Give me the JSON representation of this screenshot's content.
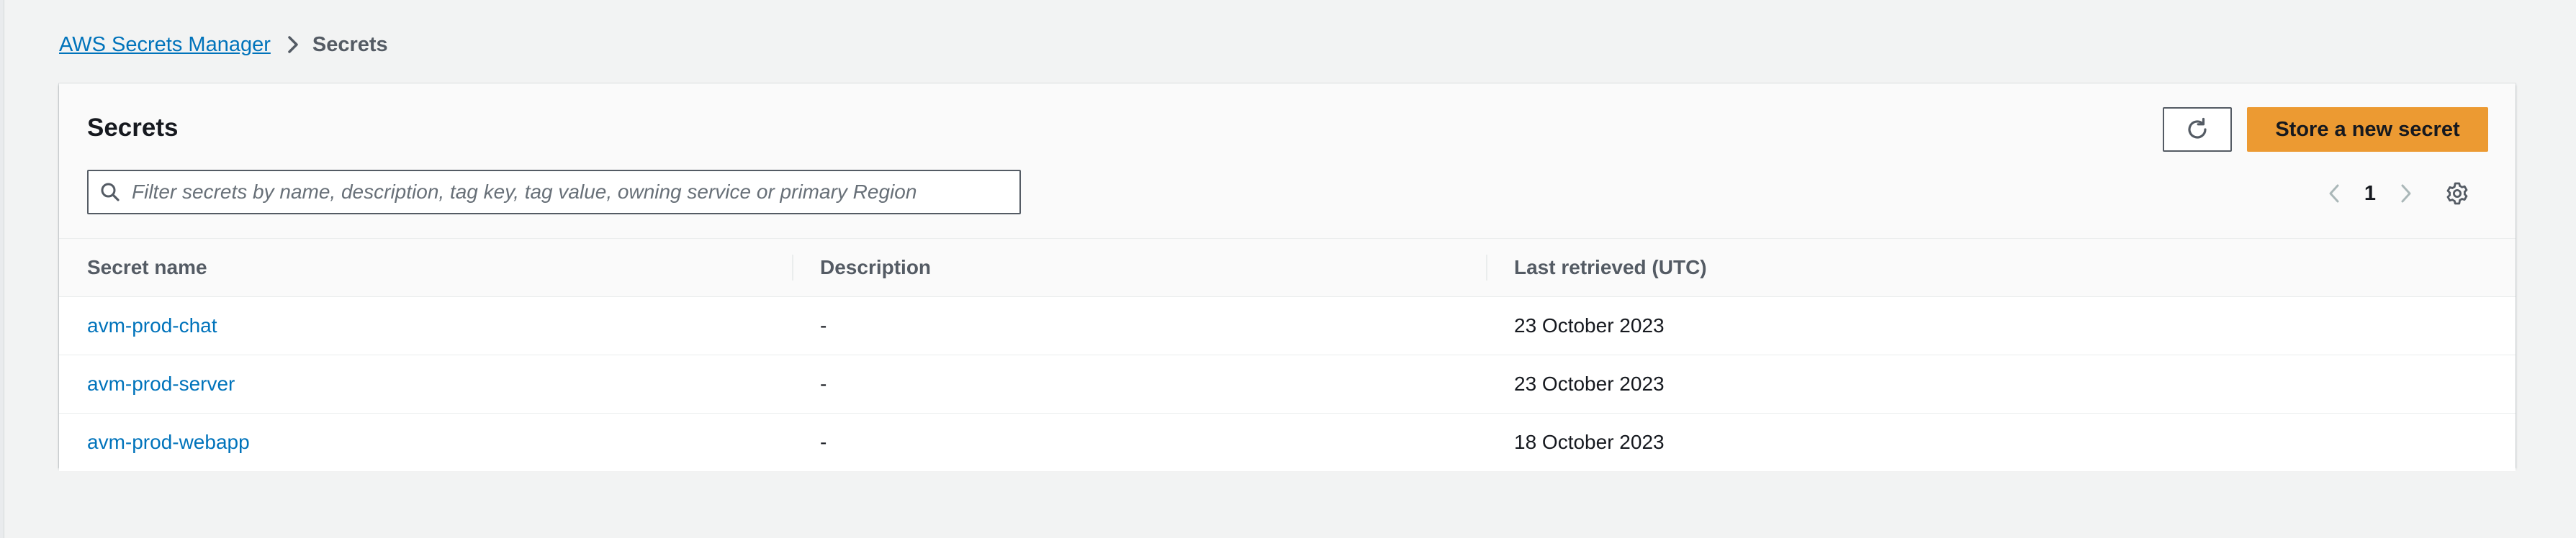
{
  "breadcrumb": {
    "root_label": "AWS Secrets Manager",
    "current_label": "Secrets"
  },
  "panel": {
    "title": "Secrets",
    "primary_button_label": "Store a new secret"
  },
  "search": {
    "placeholder": "Filter secrets by name, description, tag key, tag value, owning service or primary Region",
    "value": ""
  },
  "pagination": {
    "current_page": "1"
  },
  "table": {
    "columns": [
      "Secret name",
      "Description",
      "Last retrieved (UTC)"
    ],
    "rows": [
      {
        "name": "avm-prod-chat",
        "description": "-",
        "last_retrieved": "23 October 2023"
      },
      {
        "name": "avm-prod-server",
        "description": "-",
        "last_retrieved": "23 October 2023"
      },
      {
        "name": "avm-prod-webapp",
        "description": "-",
        "last_retrieved": "18 October 2023"
      }
    ]
  },
  "icons": {
    "breadcrumb_separator": "chevron-right-icon",
    "refresh": "refresh-icon",
    "search": "search-icon",
    "prev_page": "chevron-left-icon",
    "next_page": "chevron-right-icon",
    "settings": "gear-icon"
  },
  "colors": {
    "link": "#0073bb",
    "primary_button": "#ec9a32",
    "page_background": "#f2f3f3",
    "header_background": "#fafafa",
    "muted_text": "#545b64"
  }
}
